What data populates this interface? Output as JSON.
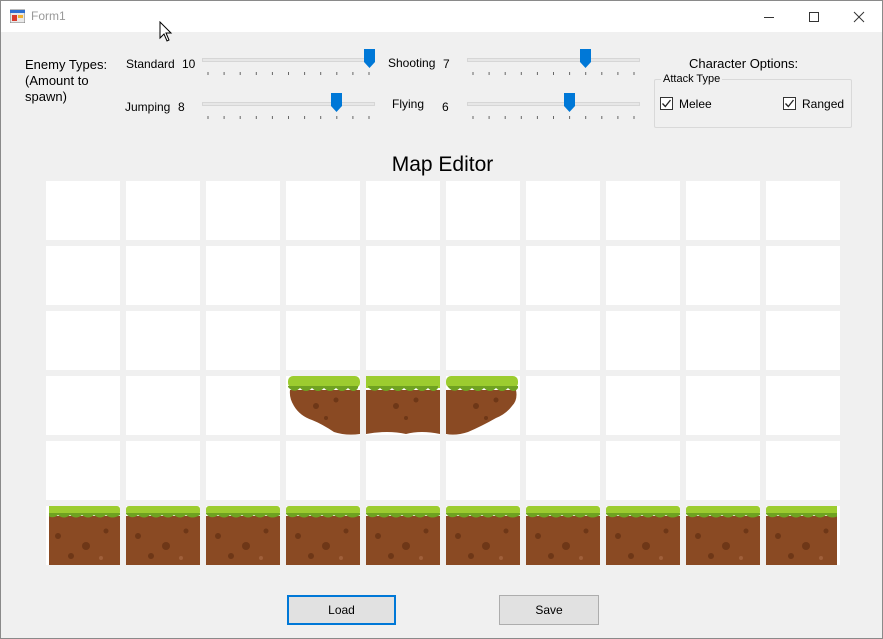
{
  "window": {
    "title": "Form1"
  },
  "enemy_types": {
    "label": "Enemy Types:\n(Amount to\nspawn)",
    "standard": {
      "label": "Standard",
      "value": "10",
      "level": 1.0
    },
    "shooting": {
      "label": "Shooting",
      "value": "7",
      "level": 0.7
    },
    "jumping": {
      "label": "Jumping",
      "value": "8",
      "level": 0.8
    },
    "flying": {
      "label": "Flying",
      "value": "6",
      "level": 0.6
    }
  },
  "character_options": {
    "label": "Character Options:",
    "attack_type": {
      "label": "Attack Type",
      "melee": {
        "label": "Melee",
        "checked": true
      },
      "ranged": {
        "label": "Ranged",
        "checked": true
      }
    }
  },
  "map_editor": {
    "title": "Map Editor",
    "rows": 6,
    "cols": 10,
    "tiles": [
      [
        "",
        "",
        "",
        "",
        "",
        "",
        "",
        "",
        "",
        ""
      ],
      [
        "",
        "",
        "",
        "",
        "",
        "",
        "",
        "",
        "",
        ""
      ],
      [
        "",
        "",
        "",
        "",
        "",
        "",
        "",
        "",
        "",
        ""
      ],
      [
        "",
        "",
        "",
        "platform-left",
        "platform-middle",
        "platform-right",
        "",
        "",
        "",
        ""
      ],
      [
        "",
        "",
        "",
        "",
        "",
        "",
        "",
        "",
        "",
        ""
      ],
      [
        "ground-left",
        "ground",
        "ground",
        "ground",
        "ground",
        "ground",
        "ground",
        "ground",
        "ground",
        "ground-right"
      ]
    ]
  },
  "buttons": {
    "load": "Load",
    "save": "Save"
  },
  "colors": {
    "accent": "#0078d7",
    "grass": "#9ccc2f",
    "dirt": "#8a4a23"
  }
}
